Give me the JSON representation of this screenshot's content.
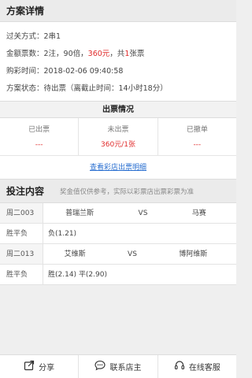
{
  "plan": {
    "title": "方案详情",
    "rows": [
      {
        "label": "过关方式：",
        "value": "2串1"
      },
      {
        "label": "金额票数：",
        "value_prefix": "2注，90倍，",
        "value_red": "360元",
        "value_mid": "，共",
        "value_red2": "1",
        "value_suffix": "张票"
      },
      {
        "label": "购彩时间：",
        "value": "2018-02-06 09:40:58"
      },
      {
        "label": "方案状态：",
        "value": "待出票（离截止时间：14小时18分）"
      }
    ]
  },
  "tickets": {
    "title": "出票情况",
    "stats": [
      {
        "label": "已出票",
        "value": "---"
      },
      {
        "label": "未出票",
        "value": "360元/1张"
      },
      {
        "label": "已撤单",
        "value": "---"
      }
    ],
    "link": "查看彩店出票明细"
  },
  "bets": {
    "title": "投注内容",
    "note": "奖金值仅供参考，实际以彩票店出票彩票为准",
    "matches": [
      {
        "id": "周二003",
        "home": "普瑞兰斯",
        "vs": "VS",
        "away": "马赛",
        "bet_type": "胜平负",
        "options": "负(1.21)"
      },
      {
        "id": "周二013",
        "home": "艾维斯",
        "vs": "VS",
        "away": "博阿维斯",
        "bet_type": "胜平负",
        "options": "胜(2.14)  平(2.90)"
      }
    ]
  },
  "bottom_bar": {
    "items": [
      {
        "icon": "share-icon",
        "label": "分享"
      },
      {
        "icon": "chat-icon",
        "label": "联系店主"
      },
      {
        "icon": "headset-icon",
        "label": "在线客服"
      }
    ]
  }
}
